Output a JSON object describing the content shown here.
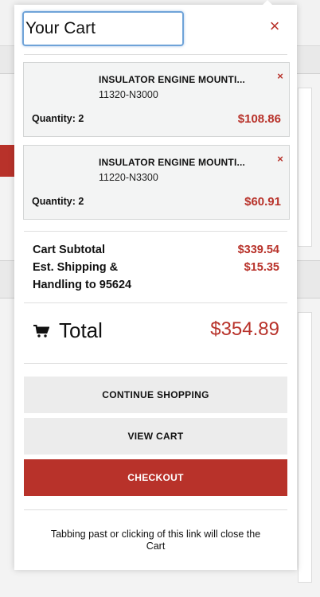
{
  "cart": {
    "title": "Your Cart",
    "close_symbol": "×",
    "items": [
      {
        "name": "INSULATOR ENGINE MOUNTI...",
        "part_number": "11320-N3000",
        "quantity_label": "Quantity: 2",
        "price": "$108.86",
        "remove_symbol": "×"
      },
      {
        "name": "INSULATOR ENGINE MOUNTI...",
        "part_number": "11220-N3300",
        "quantity_label": "Quantity: 2",
        "price": "$60.91",
        "remove_symbol": "×"
      }
    ],
    "summary": {
      "subtotal_label": "Cart Subtotal",
      "subtotal_value": "$339.54",
      "shipping_label_line1": "Est. Shipping &",
      "shipping_label_line2": "Handling to 95624",
      "shipping_value": "$15.35"
    },
    "total": {
      "icon": "shopping-cart-icon",
      "label": "Total",
      "value": "$354.89"
    },
    "buttons": {
      "continue_shopping": "CONTINUE SHOPPING",
      "view_cart": "VIEW CART",
      "checkout": "CHECKOUT"
    },
    "close_note": "Tabbing past or clicking of this link will close the Cart"
  },
  "colors": {
    "accent_red": "#b8322a",
    "focus_blue": "#6fa3d8",
    "button_grey": "#ececec"
  }
}
